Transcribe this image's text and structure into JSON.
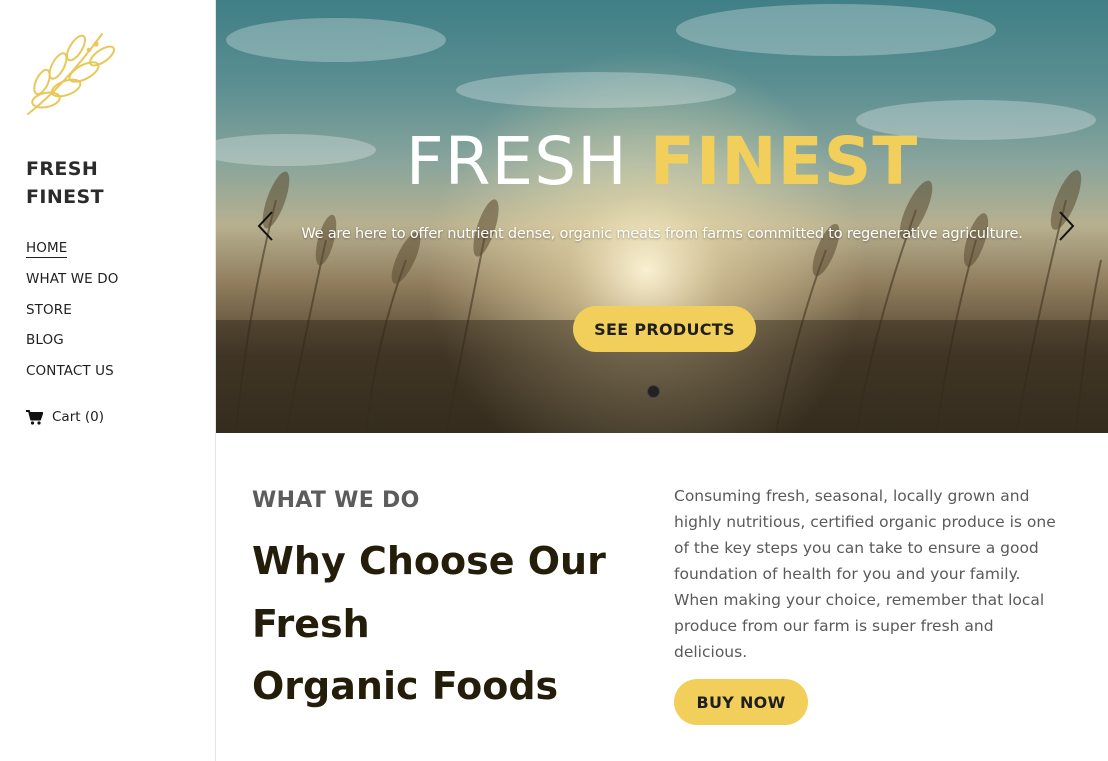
{
  "sidebar": {
    "brand_line1": "FRESH",
    "brand_line2": "FINEST",
    "nav": [
      {
        "label": "HOME"
      },
      {
        "label": "WHAT WE DO"
      },
      {
        "label": "STORE"
      },
      {
        "label": "BLOG"
      },
      {
        "label": "CONTACT US"
      }
    ],
    "cart_label": "Cart (0)"
  },
  "hero": {
    "title_word1": "FRESH",
    "title_word2": "FINEST",
    "subtitle": "We are here to offer nutrient dense, organic meats from farms committed to regenerative agriculture.",
    "button_label": "SEE PRODUCTS"
  },
  "section": {
    "eyebrow": "WHAT WE DO",
    "headline_line1": "Why Choose Our",
    "headline_line2": "Fresh",
    "headline_line3": "Organic Foods",
    "description_lines": [
      "Consuming fresh, seasonal, locally grown and",
      "highly nutritious, certified organic produce is one",
      "of the key steps you can take to ensure a good",
      "foundation of health for you and your family.",
      "When making your choice, remember that local",
      "produce from our farm is super fresh and",
      "delicious."
    ],
    "button_label": "BUY NOW"
  },
  "colors": {
    "accent": "#f2cf5b",
    "heading_dark": "#241d0a",
    "eyebrow_gray": "#5c5c5c",
    "body_gray": "#5a5a5a"
  },
  "icons": {
    "logo": "wheat-logo-icon",
    "cart": "shopping-cart-icon",
    "prev": "chevron-left-icon",
    "next": "chevron-right-icon"
  }
}
